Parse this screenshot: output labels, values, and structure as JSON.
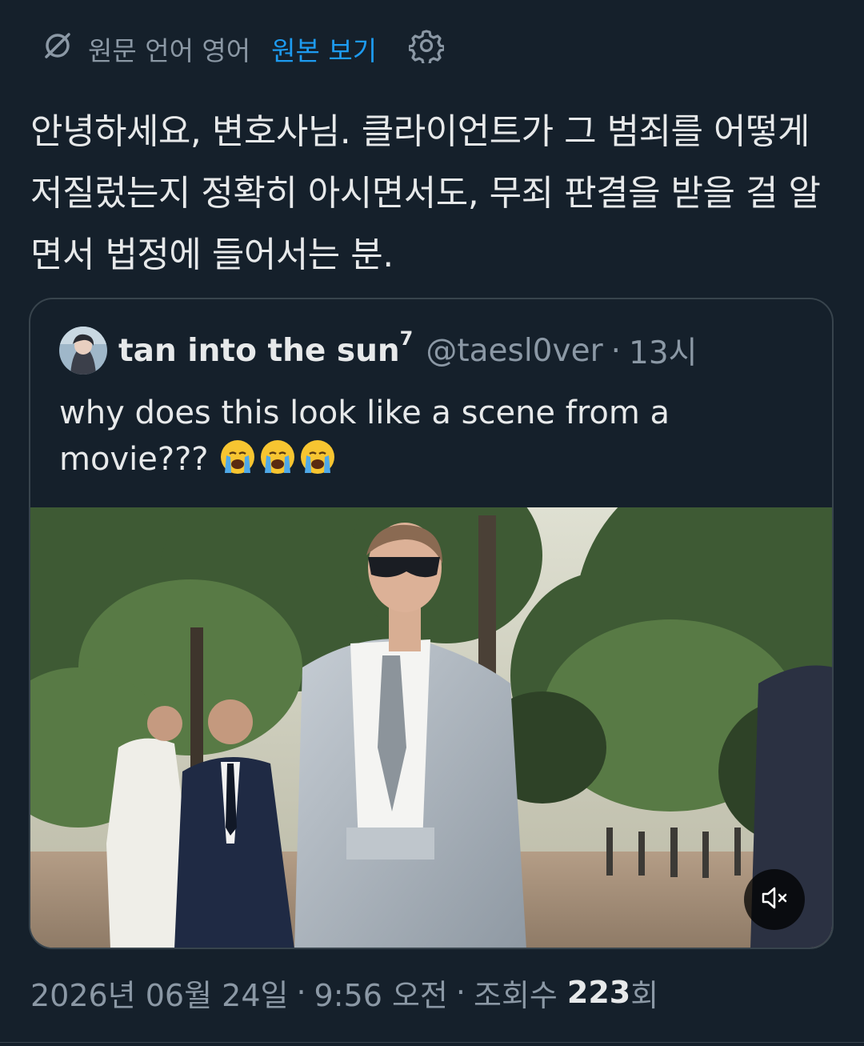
{
  "translation_bar": {
    "icon": "translate-slash-icon",
    "source_language_label": "원문 언어 영어",
    "view_original_label": "원본 보기",
    "settings_icon": "gear-icon"
  },
  "tweet": {
    "text": "안녕하세요, 변호사님. 클라이언트가 그 범죄를 어떻게 저질렀는지 정확히 아시면서도, 무죄 판결을 받을 걸 알면서 법정에 들어서는 분.",
    "date": "2026년 06월 24일",
    "time": "9:56 오전",
    "views_label": "조회수",
    "views_count": "223",
    "views_suffix": "회",
    "separator": "·"
  },
  "quoted_tweet": {
    "display_name": "tan into the sun",
    "name_superscript": "7",
    "handle": "@taesl0ver",
    "time": "13시",
    "text": "why does this look like a scene from a movie???",
    "emoji_count": 3,
    "media": {
      "type": "video",
      "mute_icon": "speaker-muted-icon"
    }
  },
  "colors": {
    "background": "#15202b",
    "text": "#e7e9ea",
    "muted": "#8b98a5",
    "accent": "#1d9bf0",
    "border": "#38444d"
  }
}
